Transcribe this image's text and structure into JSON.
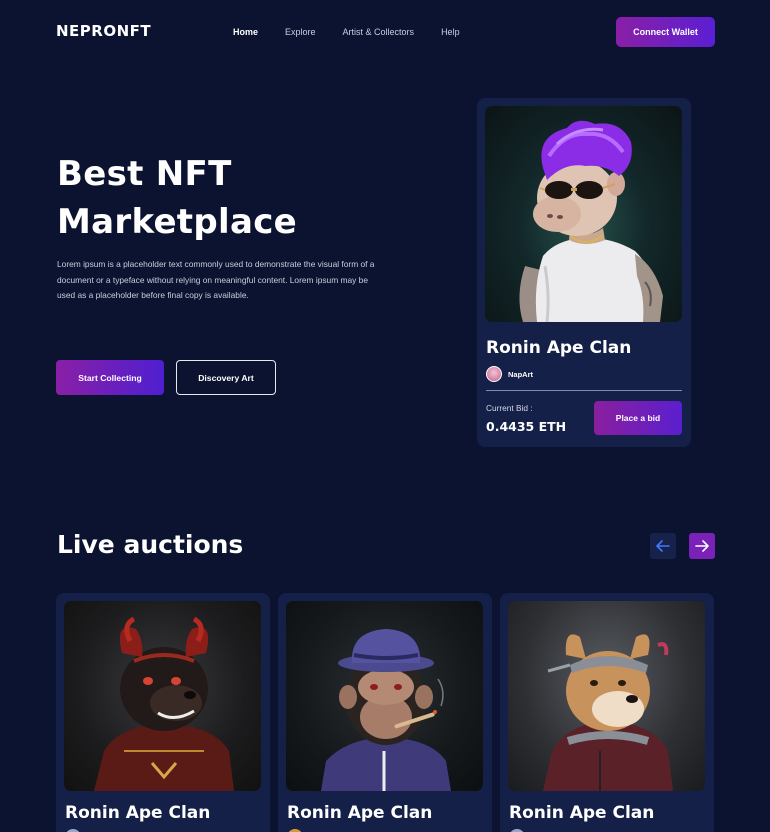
{
  "nav": {
    "logo": "NEPRONFT",
    "links": [
      "Home",
      "Explore",
      "Artist & Collectors",
      "Help"
    ],
    "active_link": "Home",
    "connect_label": "Connect Wallet"
  },
  "hero": {
    "title_line1": "Best NFT",
    "title_line2": "Marketplace",
    "description": "Lorem ipsum is a placeholder text commonly used to demonstrate the visual form of a document or a typeface without relying on meaningful content. Lorem ipsum may be used as a placeholder before final copy is available.",
    "primary_button": "Start Collecting",
    "secondary_button": "Discovery Art"
  },
  "featured": {
    "title": "Ronin Ape Clan",
    "artist": "NapArt",
    "bid_label": "Current Bid :",
    "bid_value": "0.4435 ETH",
    "bid_button": "Place a bid"
  },
  "auctions": {
    "section_title": "Live auctions",
    "prev_icon": "arrow-left-icon",
    "next_icon": "arrow-right-icon",
    "items": [
      {
        "title": "Ronin Ape Clan",
        "image": "devil-dog-nft"
      },
      {
        "title": "Ronin Ape Clan",
        "image": "chimp-with-hat-nft"
      },
      {
        "title": "Ronin Ape Clan",
        "image": "shiba-with-visor-nft"
      }
    ]
  },
  "colors": {
    "background": "#0b1330",
    "card": "#142047",
    "accent_start": "#8a1fa6",
    "accent_end": "#5b1fd3"
  }
}
